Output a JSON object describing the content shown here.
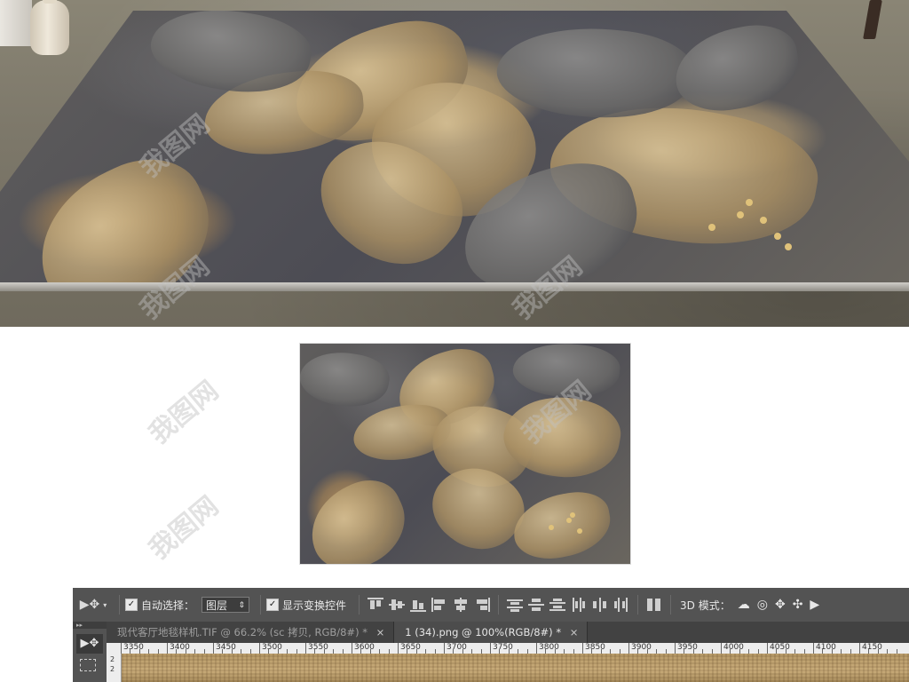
{
  "watermark": {
    "text": "我图网"
  },
  "photoshop": {
    "options_bar": {
      "move_tool_icon": "move-tool-icon",
      "auto_select_label": "自动选择：",
      "auto_select_checked": true,
      "auto_select_target": "图层",
      "show_transform_label": "显示变换控件",
      "show_transform_checked": true,
      "mode_3d_label": "3D 模式："
    },
    "tabs": [
      {
        "label": "现代客厅地毯样机.TIF @ 66.2% (sc 拷贝, RGB/8#) *",
        "active": false
      },
      {
        "label": "1 (34).png @ 100%(RGB/8#) *",
        "active": true
      }
    ],
    "ruler": {
      "labels": [
        "3350",
        "3400",
        "3450",
        "3500",
        "3550",
        "3600",
        "3650",
        "3700",
        "3750",
        "3800",
        "3850",
        "3900",
        "3950",
        "4000",
        "4050",
        "4100",
        "4150"
      ],
      "vertical_labels": [
        "2",
        "2"
      ]
    },
    "toolbar": {
      "collapse_label": "▸▸"
    }
  }
}
